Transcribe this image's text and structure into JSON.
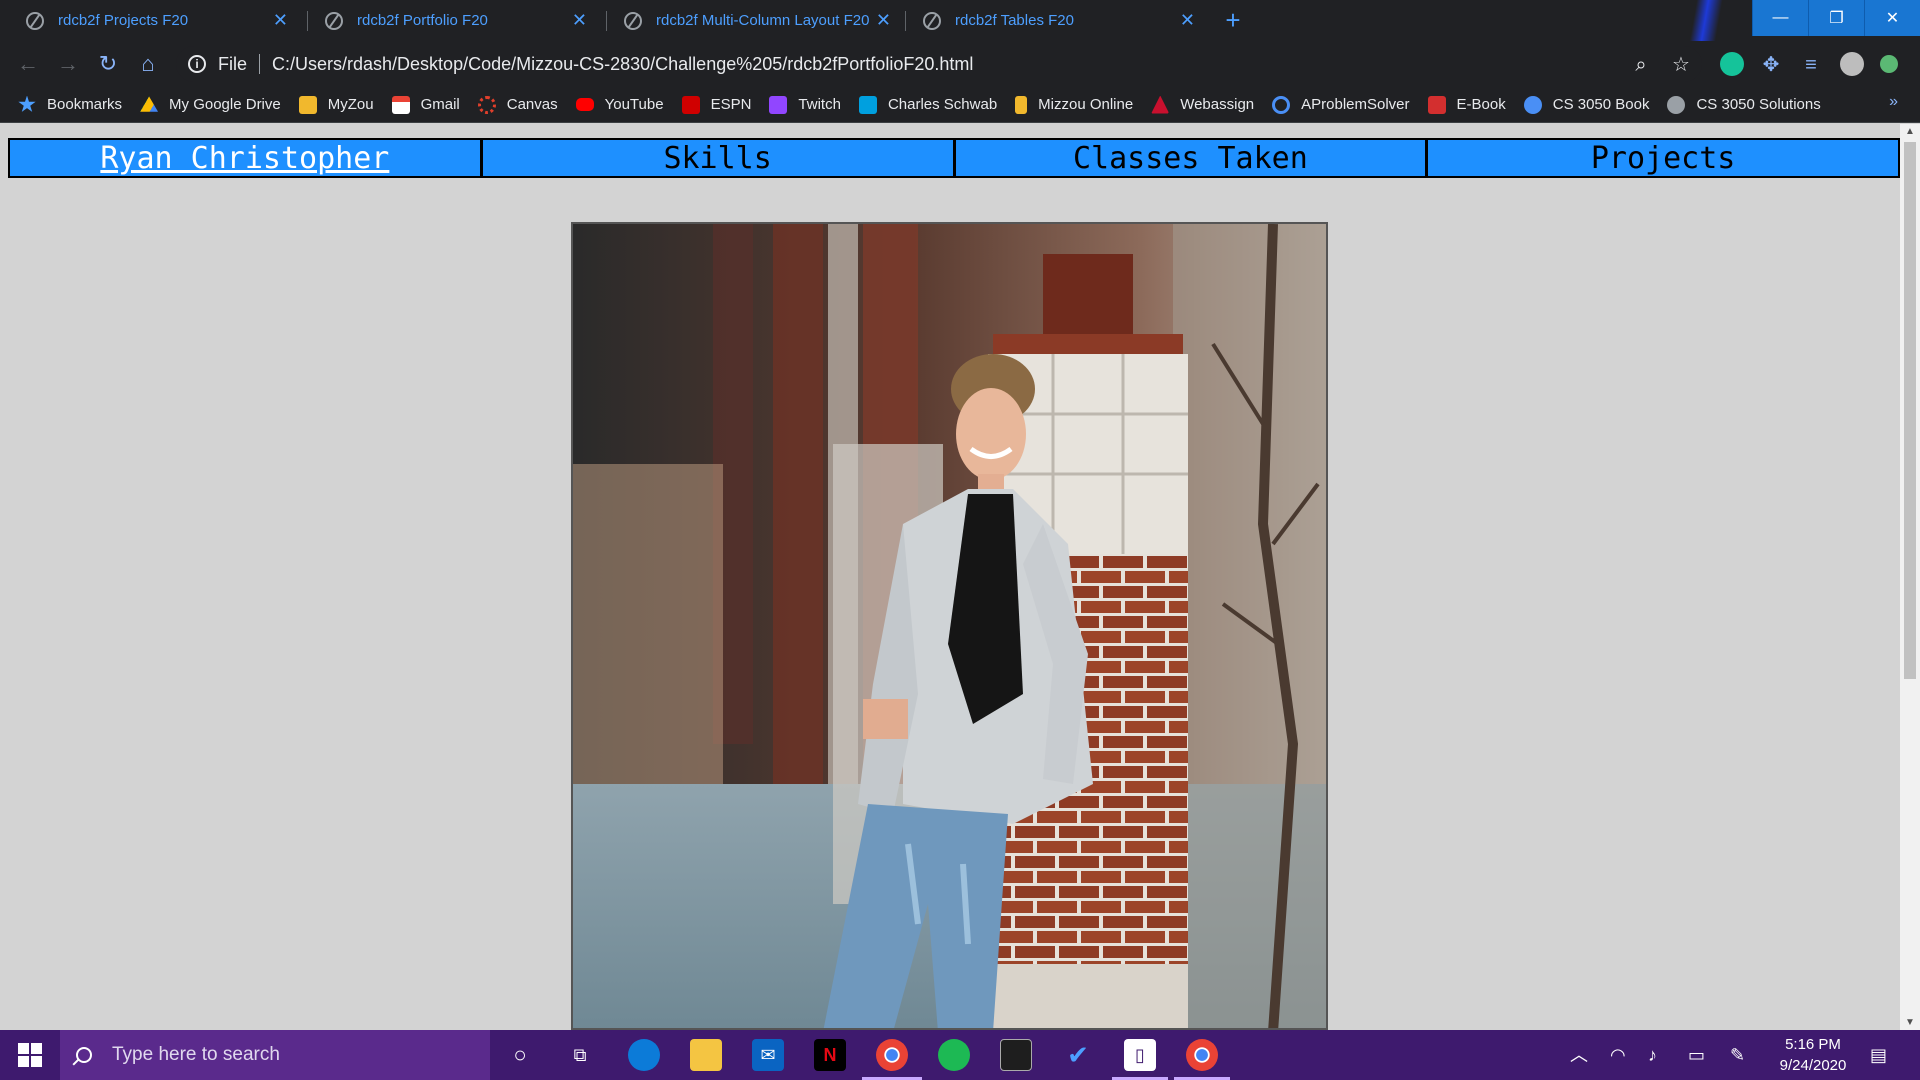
{
  "browser": {
    "tabs": [
      {
        "label": "rdcb2f Projects F20"
      },
      {
        "label": "rdcb2f Portfolio F20"
      },
      {
        "label": "rdcb2f Multi-Column Layout F20"
      },
      {
        "label": "rdcb2f Tables F20"
      }
    ],
    "omnibox": {
      "scheme_label": "File",
      "url": "C:/Users/rdash/Desktop/Code/Mizzou-CS-2830/Challenge%205/rdcb2fPortfolioF20.html"
    },
    "bookmarks": [
      {
        "label": "Bookmarks",
        "icon": "star-icon",
        "color": "#4d9fff"
      },
      {
        "label": "My Google Drive",
        "icon": "google-drive-icon",
        "color": "#fbbc04"
      },
      {
        "label": "MyZou",
        "icon": "mizzou-icon",
        "color": "#f1b82d"
      },
      {
        "label": "Gmail",
        "icon": "gmail-icon",
        "color": "#ea4335"
      },
      {
        "label": "Canvas",
        "icon": "canvas-icon",
        "color": "#e13f2b"
      },
      {
        "label": "YouTube",
        "icon": "youtube-icon",
        "color": "#ff0000"
      },
      {
        "label": "ESPN",
        "icon": "espn-icon",
        "color": "#d00000"
      },
      {
        "label": "Twitch",
        "icon": "twitch-icon",
        "color": "#9146ff"
      },
      {
        "label": "Charles Schwab",
        "icon": "schwab-icon",
        "color": "#00a0df"
      },
      {
        "label": "Mizzou Online",
        "icon": "mizzou-online-icon",
        "color": "#f1b82d"
      },
      {
        "label": "Webassign",
        "icon": "webassign-icon",
        "color": "#c8102e"
      },
      {
        "label": "AProblemSolver",
        "icon": "aproblemsolver-icon",
        "color": "#4a8ff5"
      },
      {
        "label": "E-Book",
        "icon": "ebook-icon",
        "color": "#d32f2f"
      },
      {
        "label": "CS 3050 Book",
        "icon": "globe-icon",
        "color": "#4a8ff5"
      },
      {
        "label": "CS 3050 Solutions",
        "icon": "w-icon",
        "color": "#9aa0a6"
      }
    ],
    "accent": "#1a73e8"
  },
  "page": {
    "nav": [
      {
        "label": "Ryan Christopher",
        "active": true
      },
      {
        "label": "Skills"
      },
      {
        "label": "Classes Taken"
      },
      {
        "label": "Projects"
      }
    ],
    "nav_color": "#1e90ff",
    "background": "#d3d3d3"
  },
  "taskbar": {
    "search_placeholder": "Type here to search",
    "time": "5:16 PM",
    "date": "9/24/2020",
    "color": "#3e1a6e"
  }
}
